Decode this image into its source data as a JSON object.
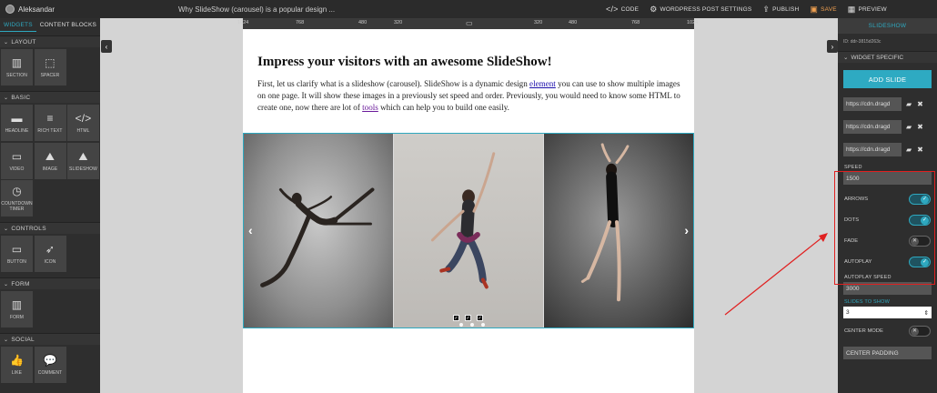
{
  "topbar": {
    "user": "Aleksandar",
    "page_title": "Why SlideShow (carousel) is a popular design ...",
    "actions": [
      {
        "icon": "code-icon",
        "glyph": "</>",
        "label": "CODE"
      },
      {
        "icon": "gear-icon",
        "glyph": "⚙",
        "label": "WORDPRESS POST SETTINGS"
      },
      {
        "icon": "upload-icon",
        "glyph": "⇪",
        "label": "PUBLISH"
      },
      {
        "icon": "save-icon",
        "glyph": "▣",
        "label": "SAVE"
      },
      {
        "icon": "preview-icon",
        "glyph": "▦",
        "label": "PREVIEW"
      }
    ]
  },
  "left": {
    "tabs": [
      "WIDGETS",
      "CONTENT BLOCKS"
    ],
    "sections": [
      {
        "title": "LAYOUT",
        "items": [
          {
            "label": "SECTION",
            "icon": "section-icon",
            "glyph": "▥"
          },
          {
            "label": "SPACER",
            "icon": "spacer-icon",
            "glyph": "⬚"
          }
        ]
      },
      {
        "title": "BASIC",
        "items": [
          {
            "label": "HEADLINE",
            "icon": "headline-icon",
            "glyph": "▬"
          },
          {
            "label": "RICH TEXT",
            "icon": "rich-text-icon",
            "glyph": "≡"
          },
          {
            "label": "HTML",
            "icon": "html-icon",
            "glyph": "</>"
          },
          {
            "label": "VIDEO",
            "icon": "video-icon",
            "glyph": "▭"
          },
          {
            "label": "IMAGE",
            "icon": "image-icon",
            "glyph": "⛰"
          },
          {
            "label": "SLIDESHOW",
            "icon": "slideshow-icon",
            "glyph": "⛰"
          },
          {
            "label": "COUNTDOWN TIMER",
            "icon": "timer-icon",
            "glyph": "◷"
          }
        ]
      },
      {
        "title": "CONTROLS",
        "items": [
          {
            "label": "BUTTON",
            "icon": "button-icon",
            "glyph": "▭"
          },
          {
            "label": "ICON",
            "icon": "rocket-icon",
            "glyph": "➶"
          }
        ]
      },
      {
        "title": "FORM",
        "items": [
          {
            "label": "FORM",
            "icon": "form-icon",
            "glyph": "▥"
          }
        ]
      },
      {
        "title": "SOCIAL",
        "items": [
          {
            "label": "LIKE",
            "icon": "like-icon",
            "glyph": "👍"
          },
          {
            "label": "COMMENT",
            "icon": "comment-icon",
            "glyph": "💬"
          }
        ]
      }
    ]
  },
  "ruler": {
    "labels": [
      "1024",
      "768",
      "480",
      "320",
      "320",
      "480",
      "768",
      "1024"
    ]
  },
  "article": {
    "heading": "Impress your visitors with an awesome SlideShow!",
    "p_a": "First, let us clarify what is a slideshow (carousel). SlideShow is a dynamic design ",
    "link1": "element",
    "p_b": " you can use to show multiple images on one page.  It will show these images in a previously set speed and order. Previously, you would need to know some HTML to create one, now there are lot of ",
    "link2": "tools",
    "p_c": " which can help you to build one easily."
  },
  "slider": {
    "prev": "‹",
    "next": "›"
  },
  "right": {
    "title": "SLIDESHOW",
    "id": "ID: ddr-3815d263c",
    "section": "WIDGET SPECIFIC",
    "add_slide": "ADD SLIDE",
    "urls": [
      "https://cdn.dragd",
      "https://cdn.dragd",
      "https://cdn.dragd"
    ],
    "speed_label": "SPEED",
    "speed_value": "1500",
    "toggles": [
      {
        "label": "ARROWS",
        "on": true
      },
      {
        "label": "DOTS",
        "on": true
      },
      {
        "label": "FADE",
        "on": false
      },
      {
        "label": "AUTOPLAY",
        "on": true
      }
    ],
    "autoplay_speed_label": "AUTOPLAY SPEED",
    "autoplay_speed_value": "3000",
    "slides_to_show_label": "SLIDES TO SHOW",
    "slides_to_show_value": "3",
    "center_mode_label": "CENTER MODE",
    "center_mode_on": false,
    "center_padding_label": "CENTER PADDING"
  },
  "colors": {
    "accent": "#2ea8bf",
    "highlight": "#e02020"
  }
}
